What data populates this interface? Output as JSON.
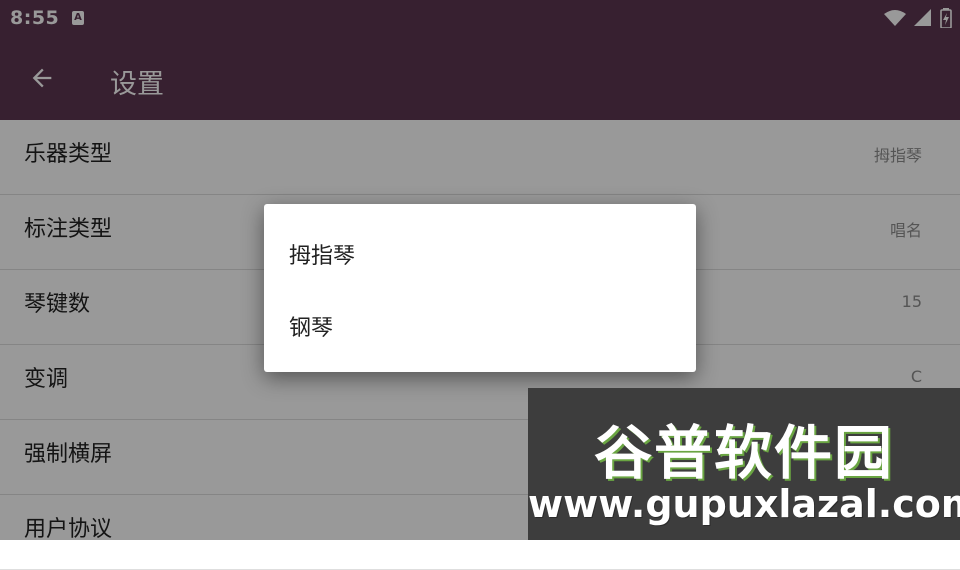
{
  "status_bar": {
    "time": "8:55",
    "notification_glyph": "A"
  },
  "toolbar": {
    "title": "设置"
  },
  "settings": [
    {
      "title": "乐器类型",
      "value": "拇指琴"
    },
    {
      "title": "标注类型",
      "value": "唱名"
    },
    {
      "title": "琴键数",
      "value": "15"
    },
    {
      "title": "变调",
      "value": "C"
    },
    {
      "title": "强制横屏",
      "value": ""
    },
    {
      "title": "用户协议",
      "value": ""
    }
  ],
  "dialog": {
    "options": [
      "拇指琴",
      "钢琴"
    ]
  },
  "watermark": {
    "title": "谷普软件园",
    "url": "www.gupuxlazal.com"
  },
  "colors": {
    "primary": "#5d3650",
    "watermark_bg": "#3d3d3d",
    "watermark_accent": "#6aa542"
  },
  "icons": {
    "back": "arrow-left-icon",
    "wifi": "wifi-icon",
    "signal": "signal-icon",
    "battery": "battery-icon"
  }
}
